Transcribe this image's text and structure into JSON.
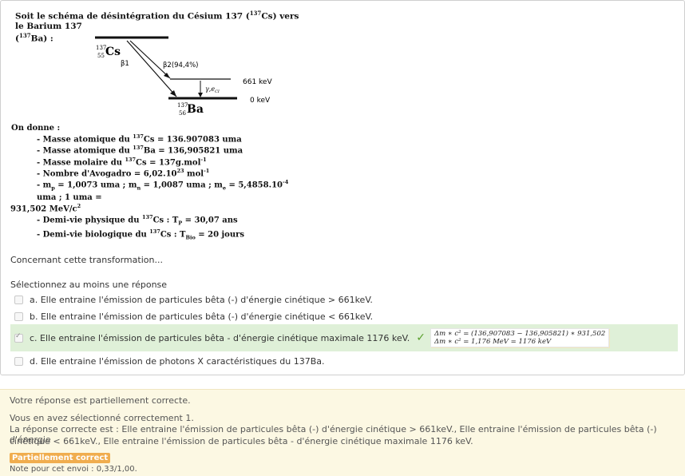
{
  "intro": {
    "text_a": "Soit le schéma de désintégration du Césium 137 (",
    "sup_a": "137",
    "text_b": "Cs) vers le Barium 137",
    "text_c": "(",
    "sup_c": "137",
    "text_d": "Ba) :"
  },
  "scheme": {
    "cs_mass": "137",
    "cs_atomic": "55",
    "cs_symbol": "Cs",
    "beta1": "β1",
    "beta2": "β2(94,4%)",
    "gamma": "γ,e",
    "gamma_sub": "CI",
    "level_high": "661 keV",
    "level_low": "0 keV",
    "ba_mass": "137",
    "ba_atomic": "56",
    "ba_symbol": "Ba"
  },
  "ondonne": {
    "title": "On donne :",
    "l1_a": "- Masse atomique du ",
    "l1_sup": "137",
    "l1_b": "Cs = 136.907083 uma",
    "l2_a": "- Masse atomique du ",
    "l2_sup": "137",
    "l2_b": "Ba = 136,905821 uma",
    "l3_a": "- Masse molaire du ",
    "l3_sup": "137",
    "l3_b": "Cs = 137g.mol",
    "l3_sup2": "-1",
    "l4_a": "- Nombre d'Avogadro = 6,02.10",
    "l4_sup": "23",
    "l4_b": " mol",
    "l4_sup2": "-1",
    "l5_a": "- m",
    "l5_sub1": "p",
    "l5_b": " = 1,0073 uma ; m",
    "l5_sub2": "n",
    "l5_c": " = 1,0087 uma ; m",
    "l5_sub3": "e",
    "l5_d": " = 5,4858.10",
    "l5_sup": "-4",
    "l5_e": " uma ; 1 uma =",
    "l6_a": "931,502 MeV/c",
    "l6_sup": "2",
    "l7_a": "- Demi-vie physique du ",
    "l7_sup": "137",
    "l7_b": "Cs : T",
    "l7_sub": "P",
    "l7_c": " = 30,07 ans",
    "l8_a": "- Demi-vie biologique du ",
    "l8_sup": "137",
    "l8_b": "Cs : T",
    "l8_sub": "Bio",
    "l8_c": " = 20 jours"
  },
  "question": {
    "stem": "Concernant cette transformation...",
    "prompt": "Sélectionnez au moins une réponse",
    "answers": [
      {
        "label": "a. Elle entraine l'émission de particules bêta (-) d'énergie cinétique > 661keV."
      },
      {
        "label": "b. Elle entraine l'émission de particules bêta (-) d'énergie cinétique < 661keV."
      },
      {
        "label": "c. Elle entraine l'émission de particules bêta - d'énergie cinétique maximale 1176 keV.",
        "feedback_1": "Δm ∗ c² = (136,907083 − 136,905821) ∗ 931,502",
        "feedback_2": "Δm ∗ c² = 1,176 MeV = 1176 keV"
      },
      {
        "label": "d. Elle entraine l'émission de photons X caractéristiques du 137Ba."
      }
    ]
  },
  "outcome": {
    "status": "Votre réponse est partiellement correcte.",
    "selected": "Vous en avez sélectionné correctement 1.",
    "correct_1": "La réponse correcte est : Elle entraine l'émission de particules bêta (-) d'énergie cinétique > 661keV., Elle entraine l'émission de particules bêta (-) d'énergie",
    "correct_2": "cinétique < 661keV., Elle entraine l'émission de particules bêta - d'énergie cinétique maximale 1176 keV.",
    "badge": "Partiellement correct",
    "grade": "Note pour cet envoi : 0,33/1,00."
  },
  "colors": {
    "correct_bg": "#dff0d8",
    "badge_bg": "#f0ad4e",
    "outcome_bg": "#fcf8e3"
  }
}
